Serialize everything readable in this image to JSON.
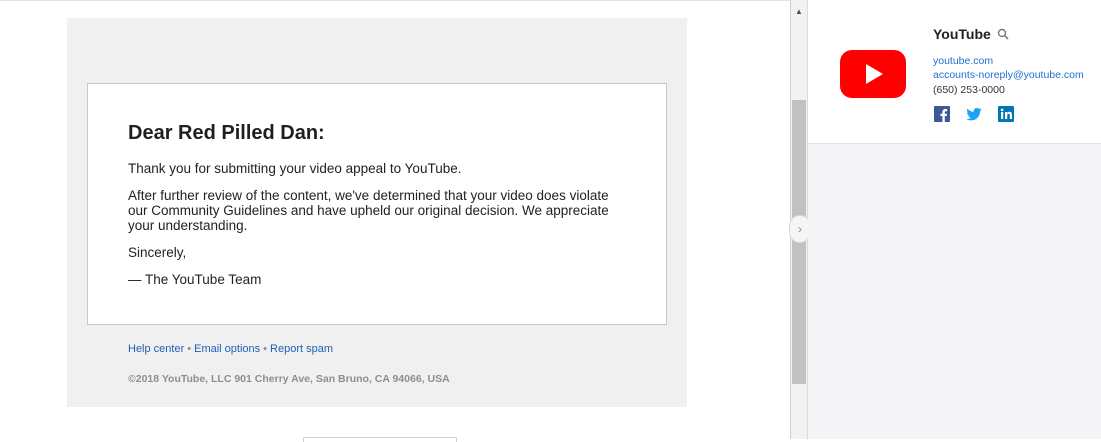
{
  "email": {
    "greeting": "Dear Red Pilled Dan:",
    "paragraphs": [
      "Thank you for submitting your video appeal to YouTube.",
      "After further review of the content, we've determined that your video does violate our Community Guidelines and have upheld our original decision. We appreciate your understanding.",
      "Sincerely,",
      "— The YouTube Team"
    ],
    "links": {
      "help": "Help center",
      "options": "Email options",
      "spam": "Report spam",
      "separator": "•"
    },
    "copyright": "©2018 YouTube, LLC 901 Cherry Ave, San Bruno, CA 94066, USA"
  },
  "contact": {
    "name": "YouTube",
    "website": "youtube.com",
    "email": "accounts-noreply@youtube.com",
    "phone": "(650) 253-0000",
    "social": [
      "facebook-icon",
      "twitter-icon",
      "linkedin-icon"
    ]
  },
  "icons": {
    "scroll_up": "▲",
    "collapse": "›"
  },
  "colors": {
    "youtube_red": "#ff0000",
    "link_blue": "#1f5fb3",
    "facebook": "#3b5998",
    "twitter": "#1da1f2",
    "linkedin": "#0077b5"
  }
}
